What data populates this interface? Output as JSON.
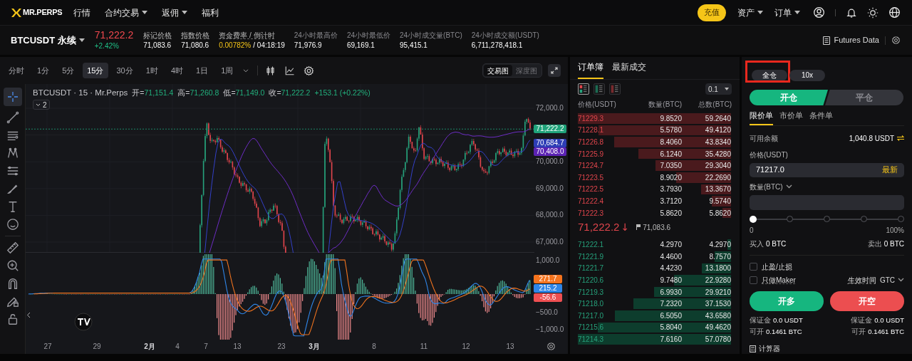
{
  "nav": {
    "logo": "MR.PERPS",
    "items": [
      {
        "label": "行情",
        "dropdown": false
      },
      {
        "label": "合约交易",
        "dropdown": true
      },
      {
        "label": "返佣",
        "dropdown": true
      },
      {
        "label": "福利",
        "dropdown": false
      }
    ],
    "deposit": "充值",
    "menus": [
      {
        "label": "资产",
        "dropdown": true
      },
      {
        "label": "订单",
        "dropdown": true
      }
    ]
  },
  "ticker": {
    "symbol": "BTCUSDT 永续",
    "price": "71,222.2",
    "change": "+2.42%",
    "stats": [
      {
        "label": "标记价格",
        "value": "71,083.6",
        "hint": true
      },
      {
        "label": "指数价格",
        "value": "71,080.6",
        "hint": true
      },
      {
        "label": "资金费率 / 倒计时",
        "value": "0.00782%",
        "countdown": "/ 04:18:19",
        "hint": true
      },
      {
        "label": "24小时最高价",
        "value": "71,976.9",
        "hint": false
      },
      {
        "label": "24小时最低价",
        "value": "69,169.1",
        "hint": false
      },
      {
        "label": "24小时成交量(BTC)",
        "value": "95,415.1",
        "hint": false
      },
      {
        "label": "24小时成交额(USDT)",
        "value": "6,711,278,418.1",
        "hint": false
      }
    ],
    "futures_data": "Futures Data"
  },
  "chart": {
    "intervals": [
      {
        "label": "分时",
        "selected": false
      },
      {
        "label": "1分",
        "selected": false
      },
      {
        "label": "5分",
        "selected": false
      },
      {
        "label": "15分",
        "selected": true
      },
      {
        "label": "30分",
        "selected": false
      },
      {
        "label": "1时",
        "selected": false
      },
      {
        "label": "4时",
        "selected": false
      },
      {
        "label": "1日",
        "selected": false
      },
      {
        "label": "1周",
        "selected": false
      }
    ],
    "views": [
      {
        "label": "交易图",
        "selected": true
      },
      {
        "label": "深度图",
        "selected": false
      }
    ],
    "legend": {
      "title": "BTCUSDT · 15 · Mr.Perps",
      "ohlc": [
        {
          "label": "开=",
          "value": "71,151.4"
        },
        {
          "label": "高=",
          "value": "71,260.8"
        },
        {
          "label": "低=",
          "value": "71,149.0"
        },
        {
          "label": "收=",
          "value": "71,222.2"
        }
      ],
      "change": "+153.1 (+0.22%)"
    },
    "indicator_count": "2",
    "price_axis": [
      "72,000.0",
      "70,000.0",
      "69,000.0",
      "68,000.0",
      "67,000.0"
    ],
    "price_tags": [
      {
        "value": "71,222.2",
        "color": "#1fa37a"
      },
      {
        "value": "70,684.7",
        "color": "#2d3db5"
      },
      {
        "value": "70,408.0",
        "color": "#5b22b3"
      }
    ],
    "macd_axis": [
      "1,000.0",
      "−500.0",
      "−1,000.0"
    ],
    "macd_tags": [
      {
        "value": "271.7",
        "color": "#f5731d"
      },
      {
        "value": "215.2",
        "color": "#2f86e8"
      },
      {
        "value": "-56.6",
        "color": "#ef4f52"
      }
    ],
    "time_axis": [
      {
        "label": "27",
        "kind": "day"
      },
      {
        "label": "29",
        "kind": "day"
      },
      {
        "label": "2月",
        "kind": "month"
      },
      {
        "label": "4",
        "kind": "day"
      },
      {
        "label": "7",
        "kind": "day"
      },
      {
        "label": "13",
        "kind": "day"
      },
      {
        "label": "23",
        "kind": "day"
      },
      {
        "label": "3月",
        "kind": "month"
      },
      {
        "label": "8",
        "kind": "day"
      },
      {
        "label": "11",
        "kind": "day"
      },
      {
        "label": "12",
        "kind": "day"
      },
      {
        "label": "13",
        "kind": "day"
      }
    ]
  },
  "orderbook": {
    "tabs": [
      {
        "label": "订单簿",
        "selected": true
      },
      {
        "label": "最新成交",
        "selected": false
      }
    ],
    "views": [
      {
        "kind": "both",
        "selected": true
      },
      {
        "kind": "bids",
        "selected": false
      },
      {
        "kind": "asks",
        "selected": false
      }
    ],
    "precision": "0.1",
    "columns": [
      "价格(USDT)",
      "数量(BTC)",
      "总数(BTC)"
    ],
    "asks": [
      {
        "price": "71229.3",
        "amount": "9.8520",
        "total": "59.2640"
      },
      {
        "price": "71228.1",
        "amount": "5.5780",
        "total": "49.4120"
      },
      {
        "price": "71226.8",
        "amount": "8.4060",
        "total": "43.8340"
      },
      {
        "price": "71225.9",
        "amount": "6.1240",
        "total": "35.4280"
      },
      {
        "price": "71224.7",
        "amount": "7.0350",
        "total": "29.3040"
      },
      {
        "price": "71223.5",
        "amount": "8.9020",
        "total": "22.2690"
      },
      {
        "price": "71222.5",
        "amount": "3.7930",
        "total": "13.3670"
      },
      {
        "price": "71222.4",
        "amount": "3.7120",
        "total": "9.5740"
      },
      {
        "price": "71222.3",
        "amount": "5.8620",
        "total": "5.8620"
      }
    ],
    "last_price": "71,222.2",
    "last_price_arrow": "↓",
    "mark_price": "71,083.6",
    "bids": [
      {
        "price": "71222.1",
        "amount": "4.2970",
        "total": "4.2970"
      },
      {
        "price": "71221.9",
        "amount": "4.4600",
        "total": "8.7570"
      },
      {
        "price": "71221.7",
        "amount": "4.4230",
        "total": "13.1800"
      },
      {
        "price": "71220.6",
        "amount": "9.7480",
        "total": "22.9280"
      },
      {
        "price": "71219.3",
        "amount": "6.9930",
        "total": "29.9210"
      },
      {
        "price": "71218.0",
        "amount": "7.2320",
        "total": "37.1530"
      },
      {
        "price": "71217.0",
        "amount": "6.5050",
        "total": "43.6580"
      },
      {
        "price": "71215.6",
        "amount": "5.8040",
        "total": "49.4620"
      },
      {
        "price": "71214.3",
        "amount": "7.6160",
        "total": "57.0780"
      }
    ]
  },
  "trade": {
    "margin": [
      {
        "label": "全仓",
        "highlighted": true
      },
      {
        "label": "10x",
        "highlighted": false
      }
    ],
    "sides": [
      {
        "label": "开仓",
        "selected": true
      },
      {
        "label": "平仓",
        "selected": false
      }
    ],
    "order_types": [
      {
        "label": "限价单",
        "selected": true
      },
      {
        "label": "市价单",
        "selected": false
      },
      {
        "label": "条件单",
        "selected": false
      }
    ],
    "available": {
      "label": "可用余额",
      "value": "1,040.8 USDT"
    },
    "price": {
      "label": "价格(USDT)",
      "value": "71217.0",
      "action": "最新"
    },
    "quantity": {
      "label": "数量(BTC)"
    },
    "slider": {
      "level": 0,
      "min": "0",
      "max": "100%"
    },
    "buy": {
      "label": "买入",
      "value": "0 BTC"
    },
    "sell": {
      "label": "卖出",
      "value": "0 BTC"
    },
    "options": [
      {
        "label": "止盈/止损",
        "checked": false
      },
      {
        "label": "只做Maker",
        "checked": false
      }
    ],
    "tif": {
      "label": "生效时间",
      "value": "GTC"
    },
    "actions": [
      {
        "label": "开多",
        "kind": "long"
      },
      {
        "label": "开空",
        "kind": "short"
      }
    ],
    "long_info": [
      {
        "label": "保证金",
        "value": "0.0 USDT"
      },
      {
        "label": "可开",
        "value": "0.1461 BTC"
      }
    ],
    "short_info": [
      {
        "label": "保证金",
        "value": "0.0 USDT"
      },
      {
        "label": "可开",
        "value": "0.1461 BTC"
      }
    ],
    "calculator": "计算器"
  }
}
